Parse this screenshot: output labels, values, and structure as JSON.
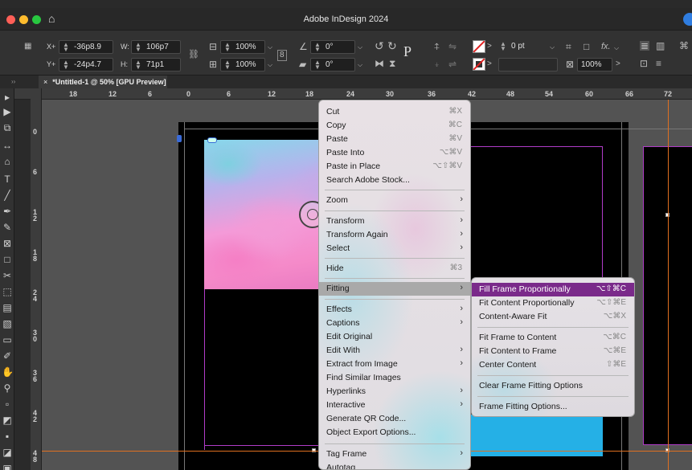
{
  "window": {
    "title": "Adobe InDesign 2024"
  },
  "control": {
    "x_label": "X+",
    "x_value": "-36p8.9",
    "y_label": "Y+",
    "y_value": "-24p4.7",
    "w_label": "W:",
    "w_value": "106p7",
    "h_label": "H:",
    "h_value": "71p1",
    "scale_x": "100%",
    "scale_y": "100%",
    "angle": "0°",
    "shear": "0°",
    "stroke_weight": "0 pt",
    "opacity": "100%",
    "fx": "fx."
  },
  "doc_tab": {
    "close": "×",
    "title": "*Untitled-1 @ 50% [GPU Preview]"
  },
  "ruler_h": [
    "18",
    "12",
    "6",
    "0",
    "6",
    "12",
    "18",
    "24",
    "30",
    "36",
    "42",
    "48",
    "54",
    "60",
    "66",
    "72"
  ],
  "ruler_v": [
    "0",
    "6",
    "1 2",
    "1 8",
    "2 4",
    "3 0",
    "3 6",
    "4 2",
    "4 8"
  ],
  "context_menu": {
    "items": [
      {
        "label": "Cut",
        "shortcut": "⌘X"
      },
      {
        "label": "Copy",
        "shortcut": "⌘C"
      },
      {
        "label": "Paste",
        "shortcut": "⌘V"
      },
      {
        "label": "Paste Into",
        "shortcut": "⌥⌘V"
      },
      {
        "label": "Paste in Place",
        "shortcut": "⌥⇧⌘V"
      },
      {
        "label": "Search Adobe Stock...",
        "shortcut": ""
      },
      {
        "label": "Zoom",
        "shortcut": ""
      },
      {
        "label": "Transform",
        "shortcut": ""
      },
      {
        "label": "Transform Again",
        "shortcut": ""
      },
      {
        "label": "Select",
        "shortcut": ""
      },
      {
        "label": "Hide",
        "shortcut": "⌘3"
      },
      {
        "label": "Fitting",
        "shortcut": ""
      },
      {
        "label": "Effects",
        "shortcut": ""
      },
      {
        "label": "Captions",
        "shortcut": ""
      },
      {
        "label": "Edit Original",
        "shortcut": ""
      },
      {
        "label": "Edit With",
        "shortcut": ""
      },
      {
        "label": "Extract from Image",
        "shortcut": ""
      },
      {
        "label": "Find Similar Images",
        "shortcut": ""
      },
      {
        "label": "Hyperlinks",
        "shortcut": ""
      },
      {
        "label": "Interactive",
        "shortcut": ""
      },
      {
        "label": "Generate QR Code...",
        "shortcut": ""
      },
      {
        "label": "Object Export Options...",
        "shortcut": ""
      },
      {
        "label": "Tag Frame",
        "shortcut": ""
      },
      {
        "label": "Autotag",
        "shortcut": ""
      }
    ]
  },
  "fitting_menu": {
    "items": [
      {
        "label": "Fill Frame Proportionally",
        "shortcut": "⌥⇧⌘C"
      },
      {
        "label": "Fit Content Proportionally",
        "shortcut": "⌥⇧⌘E"
      },
      {
        "label": "Content-Aware Fit",
        "shortcut": "⌥⌘X"
      },
      {
        "label": "Fit Frame to Content",
        "shortcut": "⌥⌘C"
      },
      {
        "label": "Fit Content to Frame",
        "shortcut": "⌥⌘E"
      },
      {
        "label": "Center Content",
        "shortcut": "⇧⌘E"
      },
      {
        "label": "Clear Frame Fitting Options",
        "shortcut": ""
      },
      {
        "label": "Frame Fitting Options...",
        "shortcut": ""
      }
    ]
  },
  "colors": {
    "highlight": "#7a2a8a",
    "frame_guides": "#b03cc8",
    "blue_fill": "#25b0e6"
  }
}
